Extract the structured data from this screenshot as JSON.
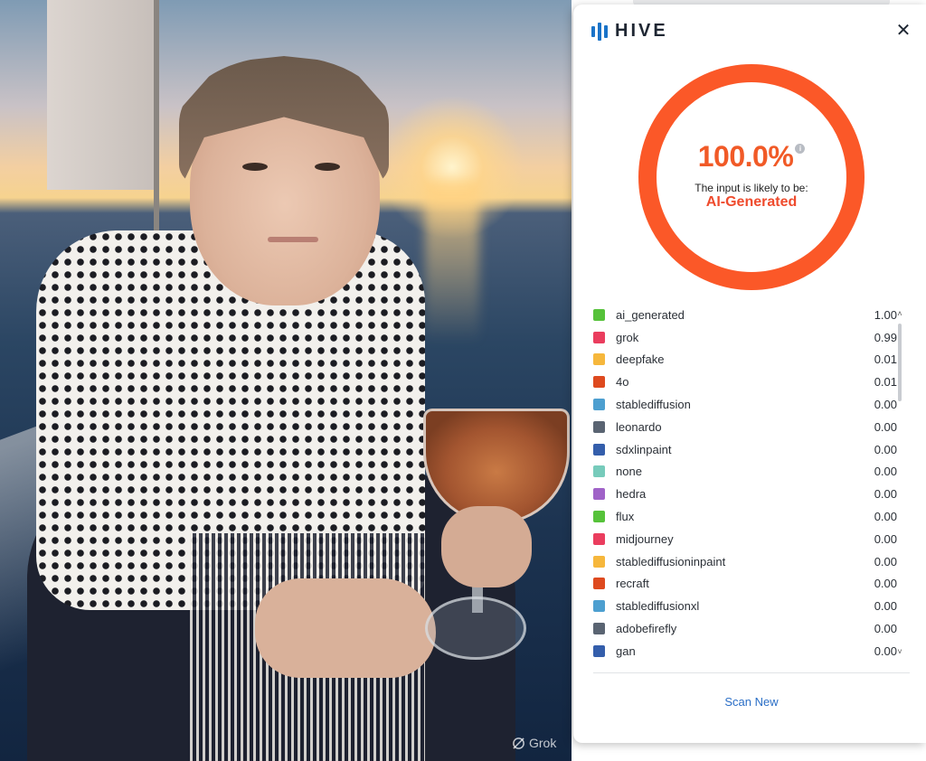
{
  "photo": {
    "alt": "AI-generated image of a young woman on a sailboat at sunset holding a cocktail",
    "watermark": "Grok"
  },
  "panel": {
    "brand": "HIVE",
    "close_icon": "close-icon",
    "score": "100.0%",
    "likely_text": "The input is likely to be:",
    "verdict": "AI-Generated",
    "scan_new": "Scan New",
    "colors": {
      "ring": "#fb5828",
      "verdict": "#ef4b2d",
      "brand": "#1a73c8",
      "link": "#2a6ec6"
    },
    "results": [
      {
        "label": "ai_generated",
        "value": "1.00",
        "color": "#56c23a"
      },
      {
        "label": "grok",
        "value": "0.99",
        "color": "#ea3d5e"
      },
      {
        "label": "deepfake",
        "value": "0.01",
        "color": "#f6b73c"
      },
      {
        "label": "4o",
        "value": "0.01",
        "color": "#de4a1f"
      },
      {
        "label": "stablediffusion",
        "value": "0.00",
        "color": "#4d9fd0"
      },
      {
        "label": "leonardo",
        "value": "0.00",
        "color": "#5a6472"
      },
      {
        "label": "sdxlinpaint",
        "value": "0.00",
        "color": "#345eab"
      },
      {
        "label": "none",
        "value": "0.00",
        "color": "#77cbbb"
      },
      {
        "label": "hedra",
        "value": "0.00",
        "color": "#a063c8"
      },
      {
        "label": "flux",
        "value": "0.00",
        "color": "#56c23a"
      },
      {
        "label": "midjourney",
        "value": "0.00",
        "color": "#ea3d5e"
      },
      {
        "label": "stablediffusioninpaint",
        "value": "0.00",
        "color": "#f6b73c"
      },
      {
        "label": "recraft",
        "value": "0.00",
        "color": "#de4a1f"
      },
      {
        "label": "stablediffusionxl",
        "value": "0.00",
        "color": "#4d9fd0"
      },
      {
        "label": "adobefirefly",
        "value": "0.00",
        "color": "#5a6472"
      },
      {
        "label": "gan",
        "value": "0.00",
        "color": "#345eab"
      }
    ]
  }
}
